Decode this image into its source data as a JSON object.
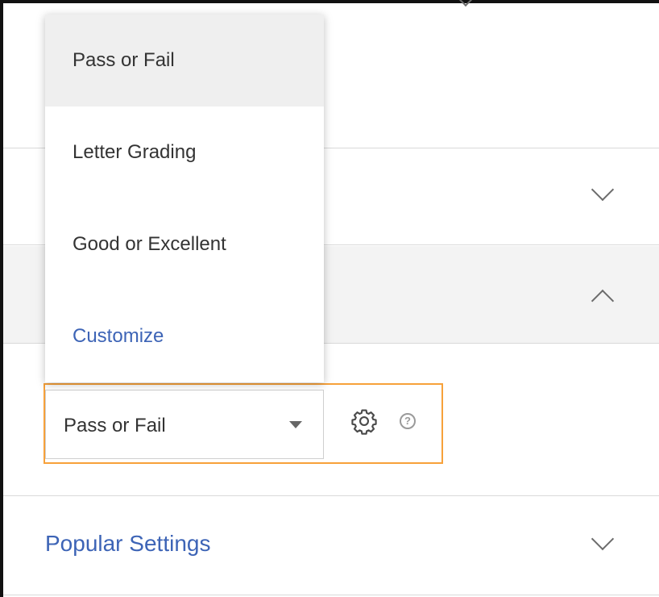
{
  "grading_dropdown": {
    "options": [
      {
        "label": "Pass or Fail",
        "selected": true
      },
      {
        "label": "Letter Grading",
        "selected": false
      },
      {
        "label": "Good or Excellent",
        "selected": false
      },
      {
        "label": "Customize",
        "link": true
      }
    ]
  },
  "grading_select": {
    "value": "Pass or Fail"
  },
  "help_icon_glyph": "?",
  "popular_settings": {
    "title": "Popular Settings"
  },
  "colors": {
    "link_blue": "#3d64b6",
    "highlight_orange": "#f7a13a",
    "expanded_row_bg": "#f3f3f3",
    "selected_option_bg": "#efefef"
  },
  "icons": {
    "gear": "gear-icon",
    "help": "help-icon",
    "chevron_down": "chevron-down-icon",
    "chevron_up": "chevron-up-icon",
    "caret_down": "caret-down-icon"
  }
}
